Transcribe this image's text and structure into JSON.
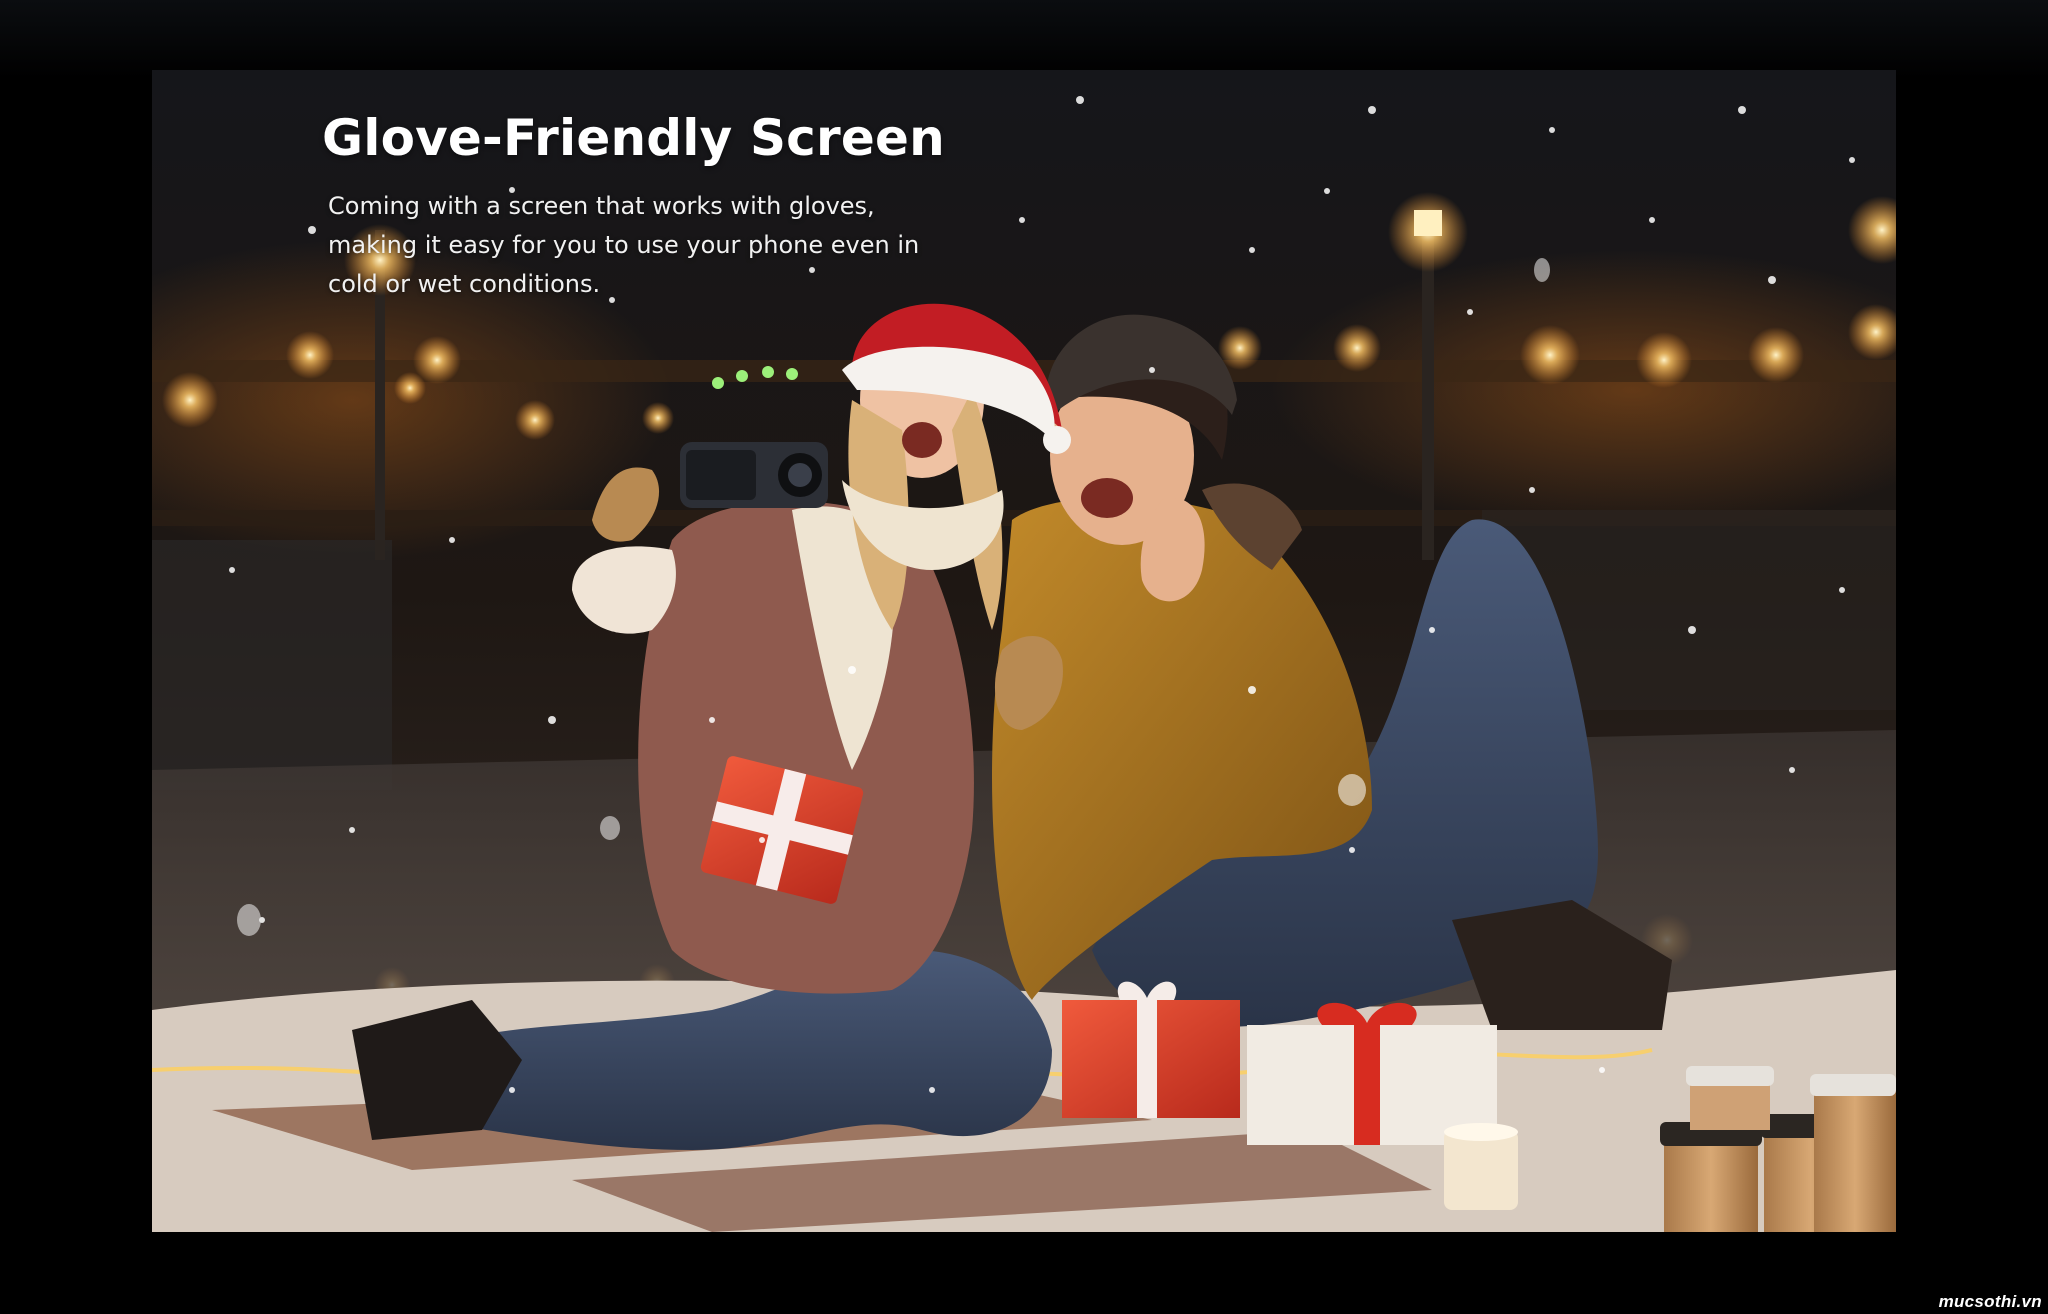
{
  "heading": "Glove-Friendly Screen",
  "description": "Coming with a screen that works with gloves, making it easy for you to use your phone even in cold or wet conditions.",
  "watermark": "mucsothi.vn",
  "photo_subject": "couple-taking-selfie-in-snow-at-night",
  "colors": {
    "background": "#000000",
    "heading_text": "#ffffff",
    "body_text": "#f1f1f1",
    "gift_red": "#d93a26",
    "jacket_mustard": "#a8741c",
    "warm_light": "#ffc868"
  }
}
